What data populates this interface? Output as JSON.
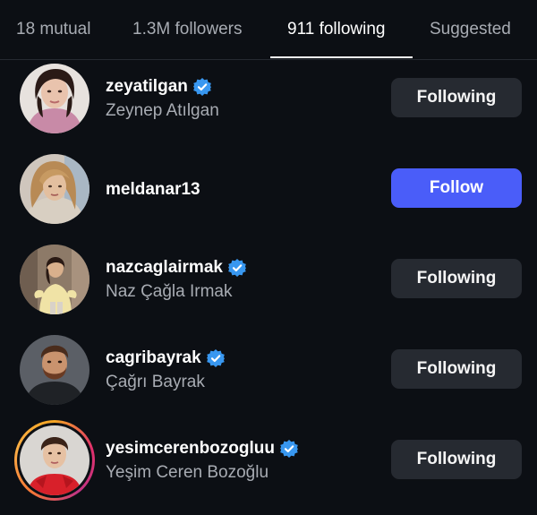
{
  "tabs": [
    {
      "label": "18 mutual",
      "active": false
    },
    {
      "label": "1.3M followers",
      "active": false
    },
    {
      "label": "911 following",
      "active": true
    },
    {
      "label": "Suggested",
      "active": false
    }
  ],
  "users": [
    {
      "username": "zeyatilgan",
      "full_name": "Zeynep Atılgan",
      "verified": true,
      "button": "Following",
      "story_ring": false
    },
    {
      "username": "meldanar13",
      "full_name": "",
      "verified": false,
      "button": "Follow",
      "story_ring": false
    },
    {
      "username": "nazcaglairmak",
      "full_name": "Naz Çağla Irmak",
      "verified": true,
      "button": "Following",
      "story_ring": false
    },
    {
      "username": "cagribayrak",
      "full_name": "Çağrı Bayrak",
      "verified": true,
      "button": "Following",
      "story_ring": false
    },
    {
      "username": "yesimcerenbozogluu",
      "full_name": "Yeşim Ceren Bozoğlu",
      "verified": true,
      "button": "Following",
      "story_ring": true
    }
  ],
  "colors": {
    "background": "#0c0f14",
    "following_button": "#262a31",
    "follow_button": "#4a5df9",
    "verified_badge": "#3897f0"
  },
  "icons": {
    "verified": "verified-badge-icon"
  }
}
